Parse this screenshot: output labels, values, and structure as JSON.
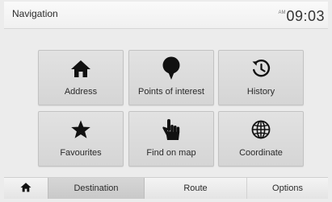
{
  "header": {
    "title": "Navigation",
    "ampm": "AM",
    "time": "09:03"
  },
  "menu": {
    "tiles": [
      {
        "label": "Address",
        "icon": "house-icon"
      },
      {
        "label": "Points of interest",
        "icon": "map-pin-icon"
      },
      {
        "label": "History",
        "icon": "history-clock-icon"
      },
      {
        "label": "Favourites",
        "icon": "star-icon"
      },
      {
        "label": "Find on map",
        "icon": "pointing-hand-icon"
      },
      {
        "label": "Coordinate",
        "icon": "globe-icon"
      }
    ]
  },
  "tabs": {
    "home_icon": "house-icon",
    "destination": "Destination",
    "route": "Route",
    "options": "Options",
    "active": "Destination"
  },
  "colors": {
    "icon": "#111111",
    "tile_bg": "#d9d9d9",
    "active_tab_bg": "#cfcfcf"
  }
}
